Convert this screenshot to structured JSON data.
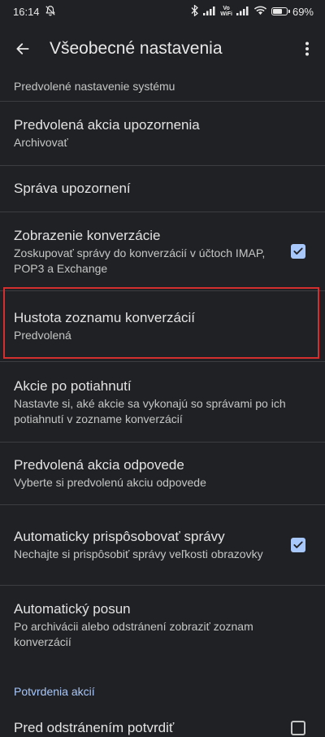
{
  "status_bar": {
    "time": "16:14",
    "vowifi_top": "Vo",
    "vowifi_bottom": "WiFi",
    "battery_percent": "69%",
    "battery_level": 0.69
  },
  "app_bar": {
    "title": "Všeobecné nastavenia"
  },
  "settings": {
    "system_default": "Predvolené nastavenie systému",
    "notification_action": {
      "title": "Predvolená akcia upozornenia",
      "subtitle": "Archivovať"
    },
    "manage_notifications": {
      "title": "Správa upozornení"
    },
    "conversation_view": {
      "title": "Zobrazenie konverzácie",
      "subtitle": "Zoskupovať správy do konverzácií v účtoch IMAP, POP3 a Exchange",
      "checked": true
    },
    "list_density": {
      "title": "Hustota zoznamu konverzácií",
      "subtitle": "Predvolená"
    },
    "swipe_actions": {
      "title": "Akcie po potiahnutí",
      "subtitle": "Nastavte si, aké akcie sa vykonajú so správami po ich potiahnutí v zozname konverzácií"
    },
    "reply_action": {
      "title": "Predvolená akcia odpovede",
      "subtitle": "Vyberte si predvolenú akciu odpovede"
    },
    "auto_fit": {
      "title": "Automaticky prispôsobovať správy",
      "subtitle": "Nechajte si prispôsobiť správy veľkosti obrazovky",
      "checked": true
    },
    "auto_advance": {
      "title": "Automatický posun",
      "subtitle": "Po archivácii alebo odstránení zobraziť zoznam konverzácií"
    },
    "section_confirmations": "Potvrdenia akcií",
    "confirm_delete": {
      "title": "Pred odstránením potvrdiť",
      "checked": false
    }
  },
  "colors": {
    "background": "#202124",
    "accent": "#a8c7fa",
    "highlight_border": "#d32f2f"
  }
}
